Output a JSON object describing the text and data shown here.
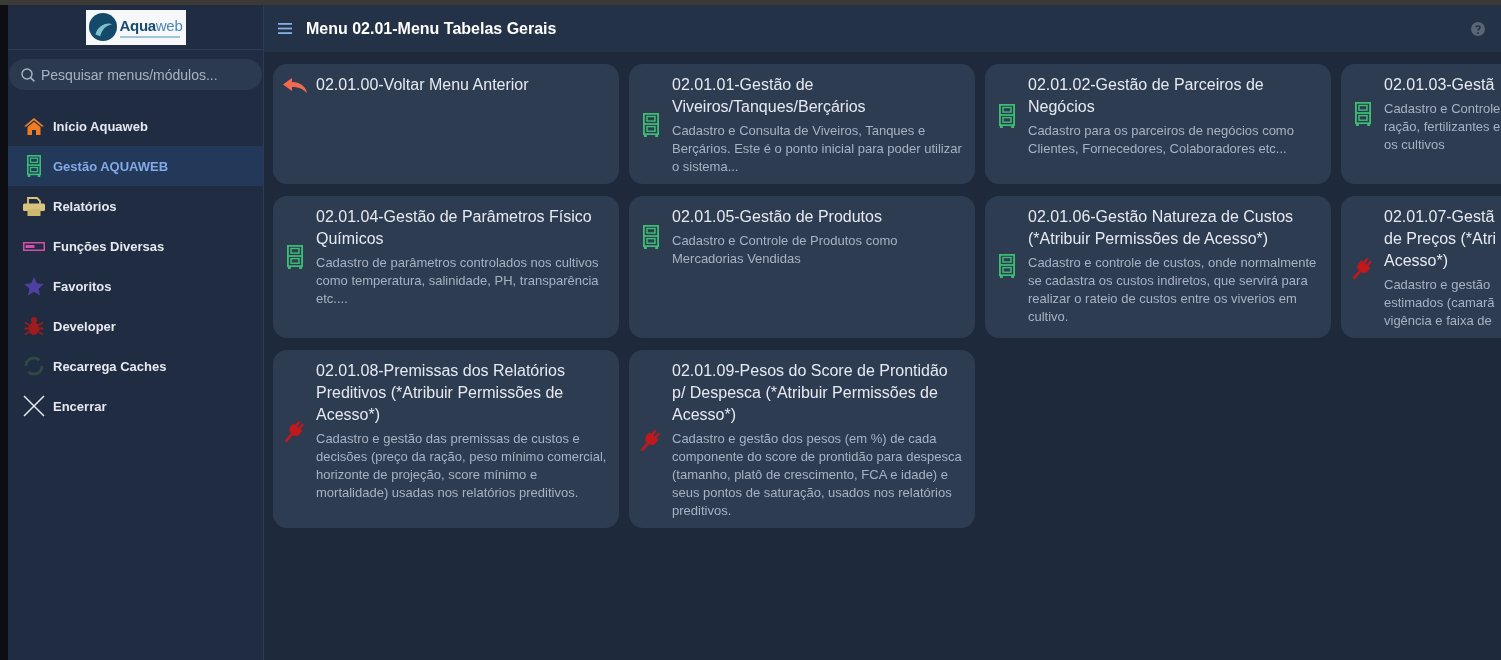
{
  "sidebar": {
    "logo": {
      "text": "**Aqua**web"
    },
    "search": {
      "placeholder": "Pesquisar menus/módulos..."
    },
    "items": [
      {
        "label": "Início Aquaweb",
        "selected": false
      },
      {
        "label": "Gestão AQUAWEB",
        "selected": true
      },
      {
        "label": "Relatórios",
        "selected": false
      },
      {
        "label": "Funções Diversas",
        "selected": false
      },
      {
        "label": "Favoritos",
        "selected": false
      },
      {
        "label": "Developer",
        "selected": false
      },
      {
        "label": "Recarrega Caches",
        "selected": false
      },
      {
        "label": "Encerrar",
        "selected": false
      }
    ]
  },
  "header": {
    "title": "Menu 02.01-Menu Tabelas Gerais"
  },
  "cards": [
    {
      "kind": "back",
      "title": "02.01.00-Voltar Menu Anterior"
    },
    {
      "kind": "module",
      "title": "02.01.01-Gestão de Viveiros/Tanques/Berçários",
      "description": "Cadastro e Consulta de Viveiros, Tanques e Berçários. Este é o ponto inicial para poder utilizar o sistema..."
    },
    {
      "kind": "module",
      "title": "02.01.02-Gestão de Parceiros de Negócios",
      "description": "Cadastro para os parceiros de negócios como Clientes, Fornecedores, Colaboradores etc..."
    },
    {
      "kind": "module",
      "title_lines": [
        "02.01.03-Gestã"
      ],
      "description_lines": [
        "Cadastro e Controle",
        "ração, fertilizantes e",
        "os cultivos"
      ]
    },
    {
      "kind": "module",
      "title": "02.01.04-Gestão de Parâmetros Físico Químicos",
      "description": "Cadastro de parâmetros controlados nos cultivos como temperatura, salinidade, PH, transparência etc...."
    },
    {
      "kind": "module",
      "title": "02.01.05-Gestão de Produtos",
      "description": "Cadastro e Controle de Produtos como Mercadorias Vendidas"
    },
    {
      "kind": "module",
      "title": "02.01.06-Gestão Natureza de Custos (*Atribuir Permissões de Acesso*)",
      "description": "Cadastro e controle de custos, onde normalmente se cadastra os custos indiretos, que servirá para realizar o rateio de custos entre os viverios em cultivo."
    },
    {
      "kind": "extension",
      "title_lines": [
        "02.01.07-Gestã",
        "de Preços (*Atri",
        "Acesso*)"
      ],
      "description_lines": [
        "Cadastro e gestão",
        "estimados (camarã",
        "vigência e faixa de"
      ]
    },
    {
      "kind": "extension",
      "title": "02.01.08-Premissas dos Relatórios Preditivos (*Atribuir Permissões de Acesso*)",
      "description": "Cadastro e gestão das premissas de custos e decisões (preço da ração, peso mínimo comercial, horizonte de projeção, score mínimo e mortalidade) usadas nos relatórios preditivos."
    },
    {
      "kind": "extension",
      "title": "02.01.09-Pesos do Score de Prontidão p/ Despesca (*Atribuir Permissões de Acesso*)",
      "description": "Cadastro e gestão dos pesos (em %) de cada componente do score de prontidão para despesca (tamanho, platô de crescimento, FCA e idade) e seus pontos de saturação, usados nos relatórios preditivos."
    }
  ]
}
